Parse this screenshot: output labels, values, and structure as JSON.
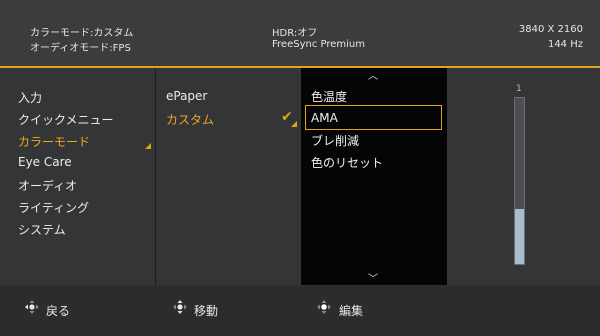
{
  "status": {
    "color_mode": "カラーモード:カスタム",
    "audio_mode": "オーディオモード:FPS",
    "hdr": "HDR:オフ",
    "freesync": "FreeSync Premium",
    "resolution": "3840 X 2160",
    "refresh": "144 Hz"
  },
  "main_menu": {
    "items": [
      {
        "label": "入力"
      },
      {
        "label": "クイックメニュー"
      },
      {
        "label": "カラーモード",
        "active": true
      },
      {
        "label": "Eye Care"
      },
      {
        "label": "オーディオ"
      },
      {
        "label": "ライティング"
      },
      {
        "label": "システム"
      }
    ]
  },
  "sub_menu": {
    "items": [
      {
        "label": "ePaper"
      },
      {
        "label": "カスタム",
        "active": true,
        "checked": true
      }
    ]
  },
  "options": {
    "items": [
      {
        "label": "色温度"
      },
      {
        "label": "AMA",
        "selected": true
      },
      {
        "label": "ブレ削減"
      },
      {
        "label": "色のリセット"
      }
    ]
  },
  "slider": {
    "value_label": "1",
    "level": 0.33
  },
  "footer": {
    "back": "戻る",
    "move": "移動",
    "enter": "編集"
  },
  "colors": {
    "accent": "#e2a21a",
    "panel": "#343537",
    "options_bg": "#050505"
  }
}
